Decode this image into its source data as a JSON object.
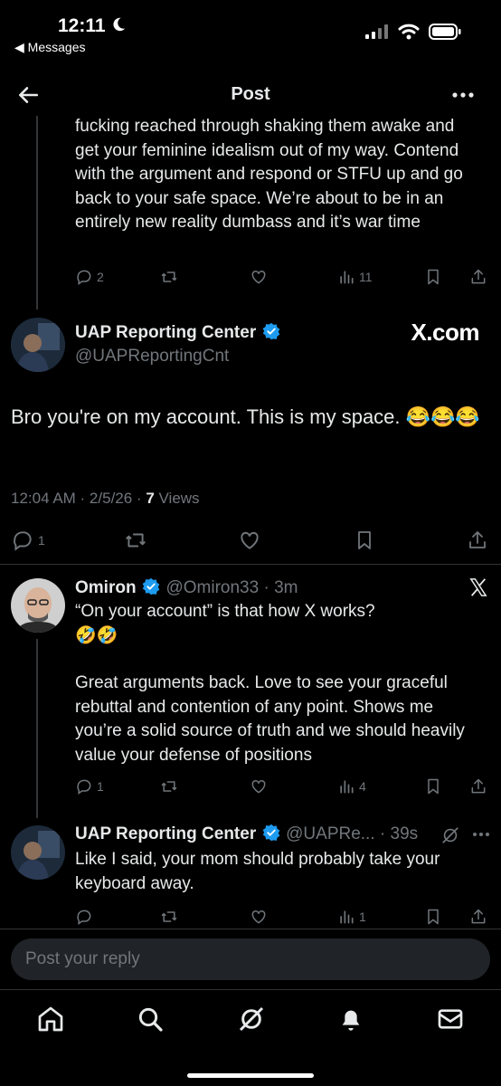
{
  "status_bar": {
    "time": "12:11",
    "back_app": "Messages"
  },
  "nav": {
    "title": "Post"
  },
  "prev_tweet": {
    "text": "fucking reached through shaking them awake and get your feminine idealism out of my way. Contend with the argument and respond or STFU up and go back to your safe space.  We’re about to be in an entirely new reality dumbass and it’s war time",
    "replies": "2",
    "views": "11"
  },
  "main_tweet": {
    "name": "UAP Reporting Center",
    "handle": "@UAPReportingCnt",
    "watermark": "X.com",
    "text": "Bro you're on my account. This is my space. 😂😂😂",
    "time": "12:04 AM · 2/5/26 · ",
    "views_count": "7",
    "views_label": " Views",
    "replies": "1"
  },
  "reply1": {
    "name": "Omiron",
    "handle": "@Omiron33 · 3m",
    "text1": "“On your account” is that how X works?",
    "emoji": "🤣🤣",
    "text2": "Great arguments back. Love to see your graceful rebuttal and contention of any point. Shows me you’re a solid source of truth and we should heavily value your defense of positions",
    "replies": "1",
    "views": "4"
  },
  "reply2": {
    "name": "UAP Reporting Center",
    "handle": "@UAPRe... · 39s",
    "text": "Like I said, your mom should probably take your keyboard away.",
    "views": "1"
  },
  "composer": {
    "placeholder": "Post your reply"
  },
  "tabs": [
    "home-icon",
    "search-icon",
    "grok-icon",
    "notifications-icon",
    "messages-icon"
  ],
  "colors": {
    "background": "#000000",
    "verified": "#1d9bf0",
    "muted": "#71767b"
  }
}
